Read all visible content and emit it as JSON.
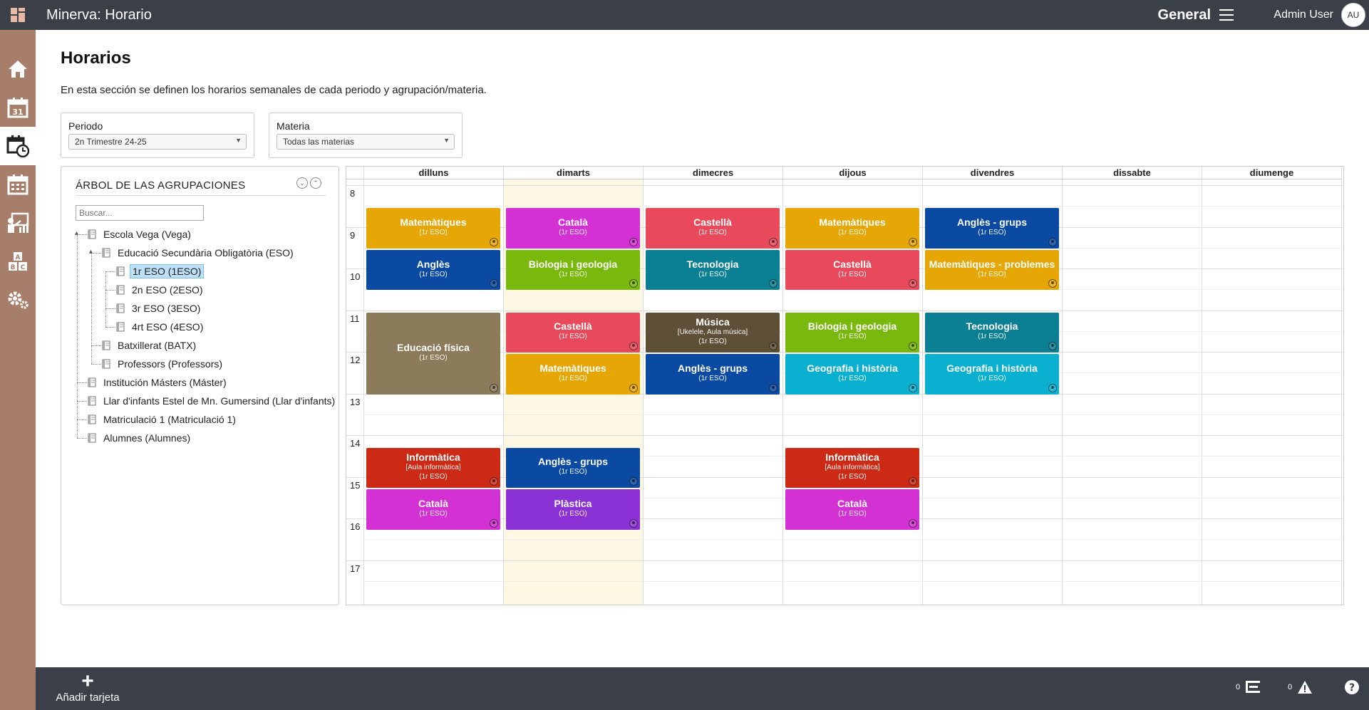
{
  "header": {
    "app_title": "Minerva: Horario",
    "context": "General",
    "user_name": "Admin User",
    "user_initials": "AU"
  },
  "sidebar": {
    "items": [
      {
        "icon": "home-icon"
      },
      {
        "icon": "calendar-31-icon"
      },
      {
        "icon": "calendar-clock-icon",
        "active": true
      },
      {
        "icon": "calendar-grid-icon"
      },
      {
        "icon": "teacher-board-icon"
      },
      {
        "icon": "abc-blocks-icon"
      },
      {
        "icon": "gears-icon"
      }
    ]
  },
  "page": {
    "title": "Horarios",
    "description": "En esta sección se definen los horarios semanales de cada periodo y agrupación/materia."
  },
  "filters": {
    "periodo_label": "Periodo",
    "periodo_value": "2n Trimestre 24-25",
    "materia_label": "Materia",
    "materia_value": "Todas las materias"
  },
  "tree": {
    "title": "ÁRBOL DE LAS AGRUPACIONES",
    "search_placeholder": "Buscar...",
    "nodes": [
      {
        "label": "Escola Vega (Vega)",
        "level": 0,
        "expanded": true
      },
      {
        "label": "Educació Secundària Obligatòria (ESO)",
        "level": 1,
        "expanded": true
      },
      {
        "label": "1r ESO (1ESO)",
        "level": 2,
        "selected": true
      },
      {
        "label": "2n ESO (2ESO)",
        "level": 2
      },
      {
        "label": "3r ESO (3ESO)",
        "level": 2
      },
      {
        "label": "4rt ESO (4ESO)",
        "level": 2
      },
      {
        "label": "Batxillerat (BATX)",
        "level": 1
      },
      {
        "label": "Professors (Professors)",
        "level": 1
      },
      {
        "label": "Institución Másters (Máster)",
        "level": 0
      },
      {
        "label": "Llar d'infants Estel de Mn. Gumersind (Llar d'infants)",
        "level": 0
      },
      {
        "label": "Matriculació 1 (Matriculació 1)",
        "level": 0
      },
      {
        "label": "Alumnes (Alumnes)",
        "level": 0
      }
    ]
  },
  "calendar": {
    "days": [
      "dilluns",
      "dimarts",
      "dimecres",
      "dijous",
      "divendres",
      "dissabte",
      "diumenge"
    ],
    "hours": [
      "8",
      "9",
      "10",
      "11",
      "12",
      "13",
      "14",
      "15",
      "16",
      "17"
    ],
    "today_index": 1,
    "events": [
      {
        "day": 0,
        "start": 8.5,
        "end": 9.5,
        "title": "Matemàtiques",
        "sub": [
          "(1r ESO)"
        ],
        "color": "#e5a606"
      },
      {
        "day": 0,
        "start": 9.5,
        "end": 10.5,
        "title": "Anglès",
        "sub": [
          "(1r ESO)"
        ],
        "color": "#0b4aa3"
      },
      {
        "day": 0,
        "start": 11,
        "end": 13,
        "title": "Educació física",
        "sub": [
          "(1r ESO)"
        ],
        "color": "#8b7b5a"
      },
      {
        "day": 0,
        "start": 14.25,
        "end": 15.25,
        "title": "Informàtica",
        "sub": [
          "[Aula informàtica]",
          "(1r ESO)"
        ],
        "color": "#cd2a15"
      },
      {
        "day": 0,
        "start": 15.25,
        "end": 16.25,
        "title": "Català",
        "sub": [
          "(1r ESO)"
        ],
        "color": "#d331d4"
      },
      {
        "day": 1,
        "start": 8.5,
        "end": 9.5,
        "title": "Català",
        "sub": [
          "(1r ESO)"
        ],
        "color": "#d331d4"
      },
      {
        "day": 1,
        "start": 9.5,
        "end": 10.5,
        "title": "Biologia i geologia",
        "sub": [
          "(1r ESO)"
        ],
        "color": "#79b80c"
      },
      {
        "day": 1,
        "start": 11,
        "end": 12,
        "title": "Castellà",
        "sub": [
          "(1r ESO)"
        ],
        "color": "#e84a5b"
      },
      {
        "day": 1,
        "start": 12,
        "end": 13,
        "title": "Matemàtiques",
        "sub": [
          "(1r ESO)"
        ],
        "color": "#e5a606"
      },
      {
        "day": 1,
        "start": 14.25,
        "end": 15.25,
        "title": "Anglès - grups",
        "sub": [
          "(1r ESO)"
        ],
        "color": "#0b4aa3"
      },
      {
        "day": 1,
        "start": 15.25,
        "end": 16.25,
        "title": "Plàstica",
        "sub": [
          "(1r ESO)"
        ],
        "color": "#8b32d6"
      },
      {
        "day": 2,
        "start": 8.5,
        "end": 9.5,
        "title": "Castellà",
        "sub": [
          "(1r ESO)"
        ],
        "color": "#e84a5b"
      },
      {
        "day": 2,
        "start": 9.5,
        "end": 10.5,
        "title": "Tecnologia",
        "sub": [
          "(1r ESO)"
        ],
        "color": "#0b7f93"
      },
      {
        "day": 2,
        "start": 11,
        "end": 12,
        "title": "Música",
        "sub": [
          "[Ukelele, Aula música]",
          "(1r ESO)"
        ],
        "color": "#5e4f37"
      },
      {
        "day": 2,
        "start": 12,
        "end": 13,
        "title": "Anglès - grups",
        "sub": [
          "(1r ESO)"
        ],
        "color": "#0b4aa3"
      },
      {
        "day": 3,
        "start": 8.5,
        "end": 9.5,
        "title": "Matemàtiques",
        "sub": [
          "(1r ESO)"
        ],
        "color": "#e5a606"
      },
      {
        "day": 3,
        "start": 9.5,
        "end": 10.5,
        "title": "Castellà",
        "sub": [
          "(1r ESO)"
        ],
        "color": "#e84a5b"
      },
      {
        "day": 3,
        "start": 11,
        "end": 12,
        "title": "Biologia i geologia",
        "sub": [
          "(1r ESO)"
        ],
        "color": "#79b80c"
      },
      {
        "day": 3,
        "start": 12,
        "end": 13,
        "title": "Geografia i història",
        "sub": [
          "(1r ESO)"
        ],
        "color": "#0ab0cf"
      },
      {
        "day": 3,
        "start": 14.25,
        "end": 15.25,
        "title": "Informàtica",
        "sub": [
          "[Aula informàtica]",
          "(1r ESO)"
        ],
        "color": "#cd2a15"
      },
      {
        "day": 3,
        "start": 15.25,
        "end": 16.25,
        "title": "Català",
        "sub": [
          "(1r ESO)"
        ],
        "color": "#d331d4"
      },
      {
        "day": 4,
        "start": 8.5,
        "end": 9.5,
        "title": "Anglès - grups",
        "sub": [
          "(1r ESO)"
        ],
        "color": "#0b4aa3"
      },
      {
        "day": 4,
        "start": 9.5,
        "end": 10.5,
        "title": "Matemàtiques - problemes",
        "sub": [
          "(1r ESO)"
        ],
        "color": "#e5a606"
      },
      {
        "day": 4,
        "start": 11,
        "end": 12,
        "title": "Tecnologia",
        "sub": [
          "(1r ESO)"
        ],
        "color": "#0b7f93"
      },
      {
        "day": 4,
        "start": 12,
        "end": 13,
        "title": "Geografia i història",
        "sub": [
          "(1r ESO)"
        ],
        "color": "#0ab0cf"
      }
    ]
  },
  "footer": {
    "add_card_label": "Añadir tarjeta",
    "list_count": "0",
    "warning_count": "0"
  }
}
